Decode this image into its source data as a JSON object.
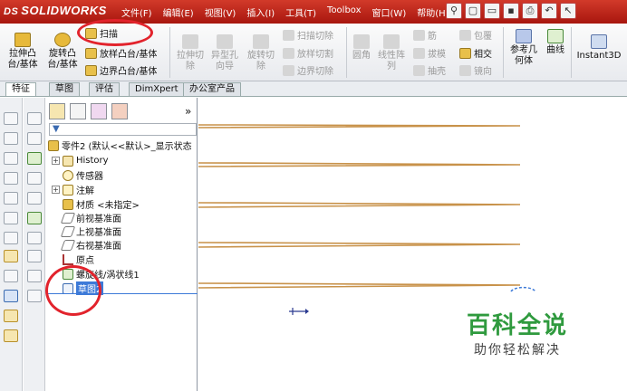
{
  "app": {
    "logo_prefix": "DS",
    "logo": "SOLIDWORKS"
  },
  "menu": [
    "文件(F)",
    "编辑(E)",
    "视图(V)",
    "插入(I)",
    "工具(T)",
    "Toolbox",
    "窗口(W)",
    "帮助(H)"
  ],
  "ribbon": {
    "extrude_boss": "拉伸凸\n台/基体",
    "revolve_boss": "旋转凸\n台/基体",
    "sweep": "扫描",
    "loft_boss": "放样凸台/基体",
    "boundary_boss": "边界凸台/基体",
    "extrude_cut": "拉伸切\n除",
    "hole_wizard": "异型孔\n向导",
    "revolve_cut": "旋转切\n除",
    "sweep_cut": "扫描切除",
    "loft_cut": "放样切割",
    "boundary_cut": "边界切除",
    "fillet": "圆角",
    "linear_pattern": "线性阵\n列",
    "rib": "筋",
    "draft": "拔模",
    "shell": "抽壳",
    "wrap": "包覆",
    "intersect": "相交",
    "mirror": "镜向",
    "ref_geometry": "参考几\n何体",
    "curves": "曲线",
    "instant3d": "Instant3D"
  },
  "tabs": [
    "特征",
    "草图",
    "评估",
    "DimXpert",
    "办公室产品"
  ],
  "tree": {
    "part": "零件2 (默认<<默认>_显示状态",
    "history": "History",
    "sensors": "传感器",
    "annotations": "注解",
    "material": "材质 <未指定>",
    "front_plane": "前视基准面",
    "top_plane": "上视基准面",
    "right_plane": "右视基准面",
    "origin": "原点",
    "helix": "螺旋线/涡状线1",
    "sketch": "草图2",
    "collapse": "»"
  },
  "watermark": {
    "title": "百科全说",
    "subtitle": "助你轻松解决"
  },
  "colors": {
    "title_red": "#c0281c",
    "helix": "#c8924a",
    "select_blue": "#3d7ad8",
    "annotation_red": "#e2232c",
    "watermark_green": "#2f9a3e"
  }
}
